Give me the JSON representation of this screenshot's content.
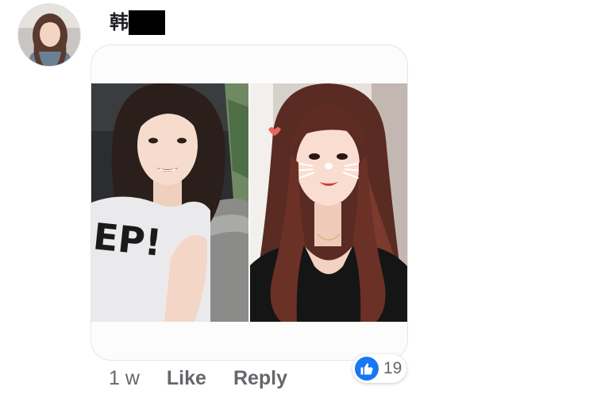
{
  "comment": {
    "author_name": "韩",
    "author_name_redacted": true,
    "timestamp": "1 w",
    "actions": {
      "like_label": "Like",
      "reply_label": "Reply"
    },
    "reactions": {
      "type_icon": "thumbs-up-icon",
      "count": "19",
      "badge_color": "#1877f2"
    },
    "attachment": {
      "type": "photo collage",
      "photos": [
        {
          "name": "left-selfie",
          "shirt_text": "YEP!"
        },
        {
          "name": "right-selfie-with-filter"
        }
      ]
    }
  },
  "colors": {
    "text_primary": "#1c1e21",
    "text_secondary": "#65676b",
    "accent": "#1877f2"
  }
}
